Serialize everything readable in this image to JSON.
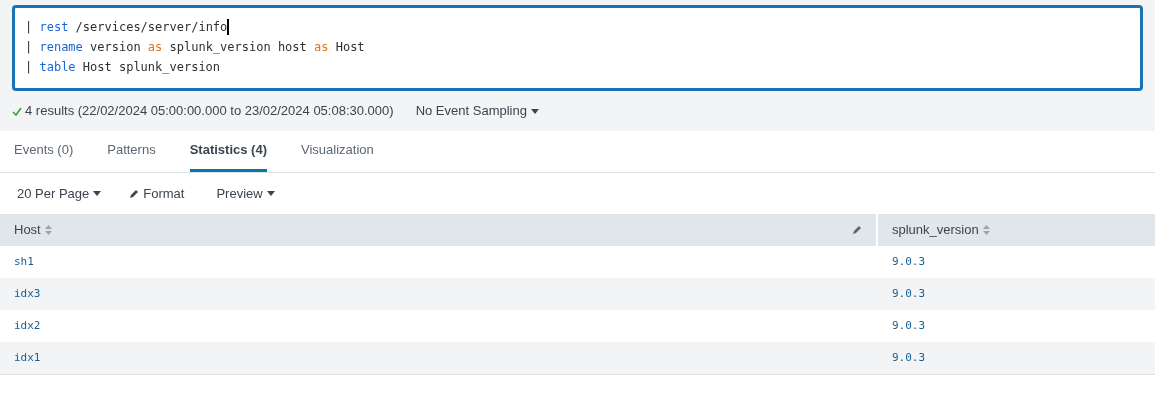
{
  "query": {
    "lines": [
      [
        {
          "text": "| ",
          "kind": "plain"
        },
        {
          "text": "rest",
          "kind": "command"
        },
        {
          "text": " /services/server/info",
          "kind": "plain"
        }
      ],
      [
        {
          "text": "| ",
          "kind": "plain"
        },
        {
          "text": "rename",
          "kind": "command"
        },
        {
          "text": " version ",
          "kind": "plain"
        },
        {
          "text": "as",
          "kind": "operator"
        },
        {
          "text": " splunk_version host ",
          "kind": "plain"
        },
        {
          "text": "as",
          "kind": "operator"
        },
        {
          "text": " Host",
          "kind": "plain"
        }
      ],
      [
        {
          "text": "| ",
          "kind": "plain"
        },
        {
          "text": "table",
          "kind": "command"
        },
        {
          "text": " Host splunk_version",
          "kind": "plain"
        }
      ]
    ]
  },
  "status": {
    "summary": "4 results (22/02/2024 05:00:00.000 to 23/02/2024 05:08:30.000)",
    "sampling": "No Event Sampling"
  },
  "tabs": [
    {
      "label": "Events (0)",
      "selected": false
    },
    {
      "label": "Patterns",
      "selected": false
    },
    {
      "label": "Statistics (4)",
      "selected": true
    },
    {
      "label": "Visualization",
      "selected": false
    }
  ],
  "toolbar": {
    "per_page": "20 Per Page",
    "format": "Format",
    "preview": "Preview"
  },
  "table": {
    "columns": [
      {
        "label": "Host"
      },
      {
        "label": "splunk_version"
      }
    ],
    "rows": [
      [
        "sh1",
        "9.0.3"
      ],
      [
        "idx3",
        "9.0.3"
      ],
      [
        "idx2",
        "9.0.3"
      ],
      [
        "idx1",
        "9.0.3"
      ]
    ]
  }
}
